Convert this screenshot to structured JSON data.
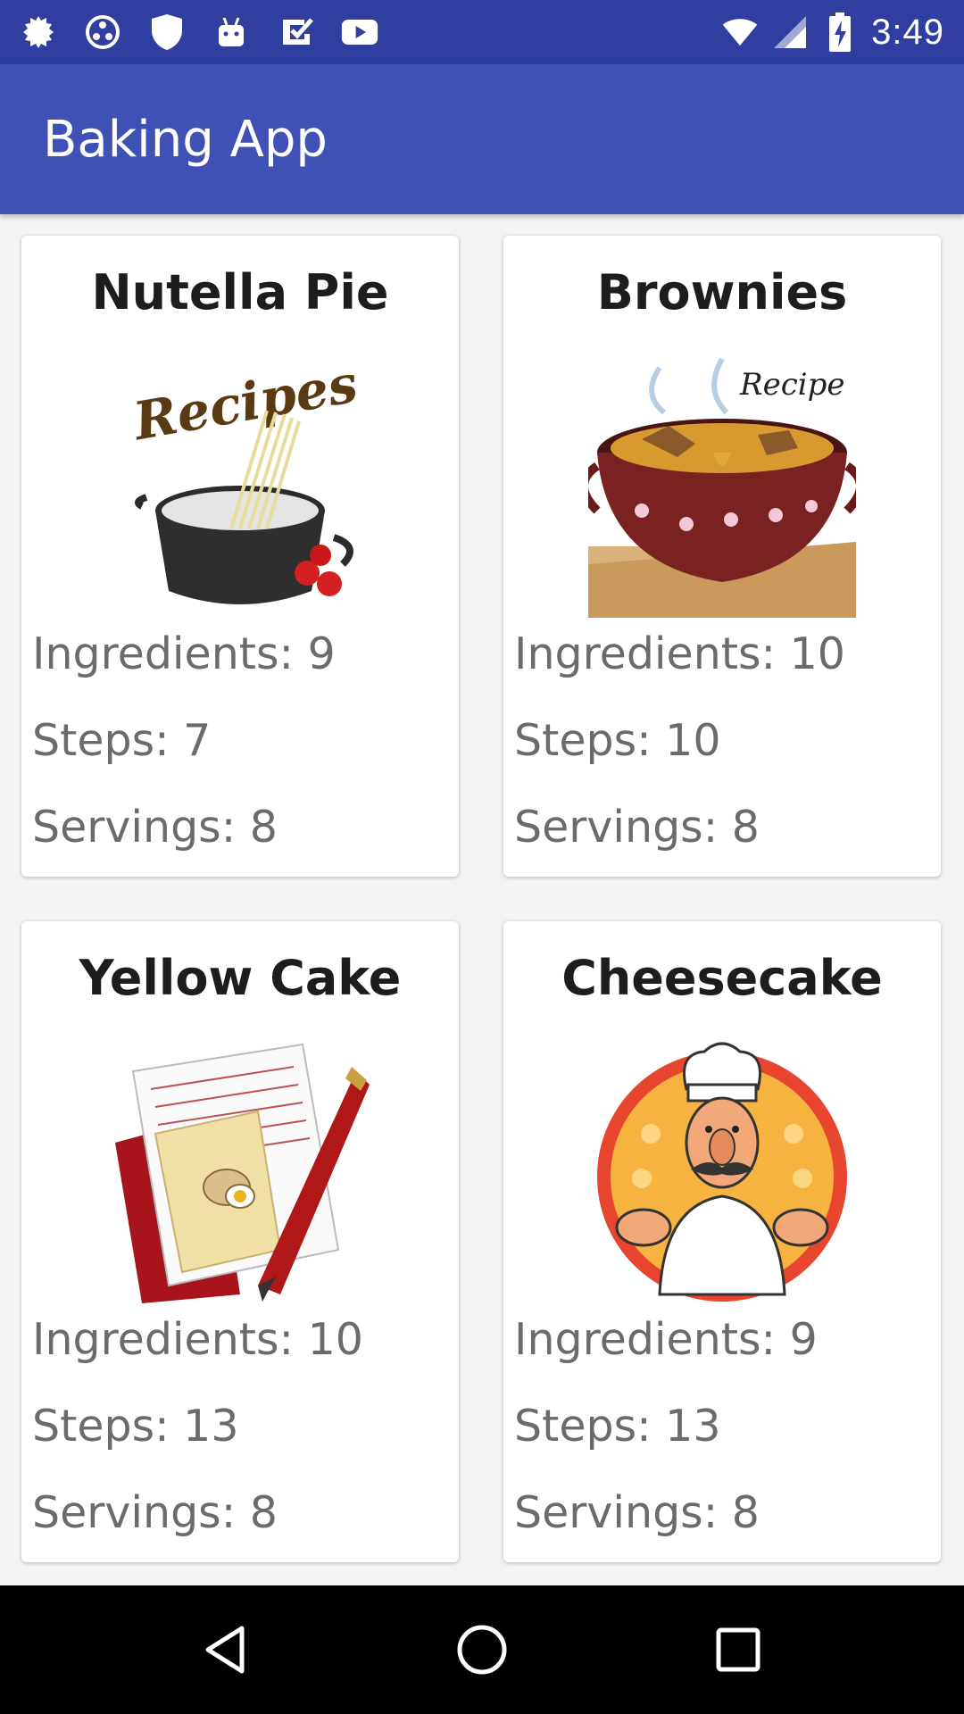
{
  "status_bar": {
    "time": "3:49",
    "left_icons": [
      "settings-gear-icon",
      "circle-dots-icon",
      "shield-icon",
      "android-icon",
      "checkbox-icon",
      "youtube-icon"
    ],
    "right_icons": [
      "wifi-icon",
      "signal-icon",
      "battery-charging-icon"
    ]
  },
  "app_bar": {
    "title": "Baking App"
  },
  "recipes": [
    {
      "name": "Nutella Pie",
      "image": "recipes-pot-illustration",
      "ingredients": "Ingredients: 9",
      "steps": "Steps: 7",
      "servings": "Servings: 8"
    },
    {
      "name": "Brownies",
      "image": "recipe-stew-pot-illustration",
      "ingredients": "Ingredients: 10",
      "steps": "Steps: 10",
      "servings": "Servings: 8"
    },
    {
      "name": "Yellow Cake",
      "image": "recipe-notes-pen-illustration",
      "ingredients": "Ingredients: 10",
      "steps": "Steps: 13",
      "servings": "Servings: 8"
    },
    {
      "name": "Cheesecake",
      "image": "chef-illustration",
      "ingredients": "Ingredients: 9",
      "steps": "Steps: 13",
      "servings": "Servings: 8"
    }
  ],
  "recipe_image_text": {
    "recipes": "Recipes",
    "recipe": "Recipe"
  },
  "nav_bar": {
    "icons": [
      "back-icon",
      "home-icon",
      "recents-icon"
    ]
  }
}
